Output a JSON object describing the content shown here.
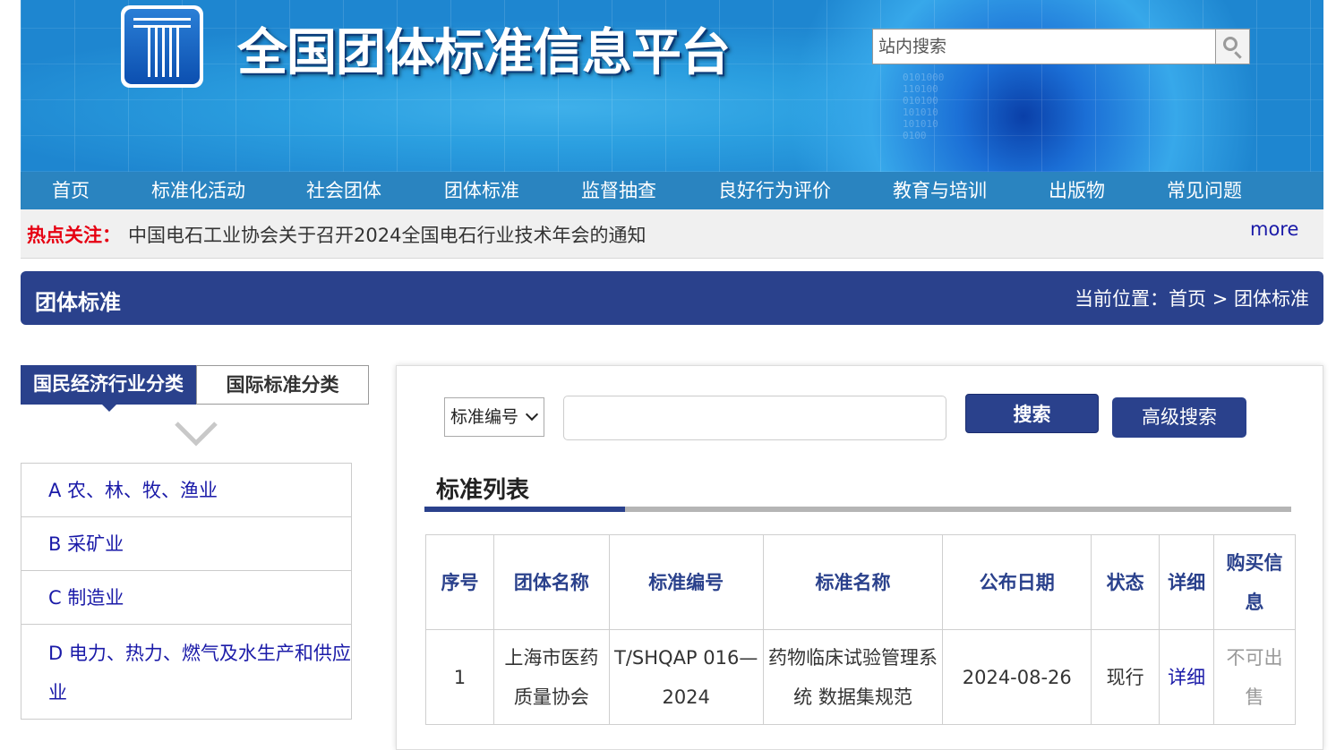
{
  "header": {
    "site_title": "全国团体标准信息平台",
    "search_placeholder": "站内搜索",
    "digits": [
      "0101000",
      "110100",
      "010100",
      "101010",
      "101010",
      "0100"
    ]
  },
  "nav": [
    "首页",
    "标准化活动",
    "社会团体",
    "团体标准",
    "监督抽查",
    "良好行为评价",
    "教育与培训",
    "出版物",
    "常见问题"
  ],
  "hotbar": {
    "label": "热点关注：",
    "news": "中国电石工业协会关于召开2024全国电石行业技术年会的通知",
    "more": "more"
  },
  "titlebar": {
    "title": "团体标准",
    "breadcrumb": "当前位置：首页 > 团体标准"
  },
  "left": {
    "tab_active": "国民经济行业分类",
    "tab_inactive": "国际标准分类",
    "categories": [
      "A 农、林、牧、渔业",
      "B 采矿业",
      "C 制造业",
      "D 电力、热力、燃气及水生产和供应业"
    ]
  },
  "search": {
    "select_value": "标准编号",
    "keyword": "",
    "search_label": "搜索",
    "advanced_label": "高级搜索"
  },
  "list": {
    "title": "标准列表",
    "headers": [
      "序号",
      "团体名称",
      "标准编号",
      "标准名称",
      "公布日期",
      "状态",
      "详细",
      "购买信息"
    ],
    "rows": [
      [
        "1",
        "上海市医药质量协会",
        "T/SHQAP 016—2024",
        "药物临床试验管理系统 数据集规范",
        "2024-08-26",
        "现行",
        "详细",
        "不可出售"
      ]
    ]
  },
  "colors": {
    "nav_bg": "#2a84c0",
    "primary_dark": "#2a418c",
    "hot_label": "#e60012",
    "link": "#1a1aa8"
  }
}
